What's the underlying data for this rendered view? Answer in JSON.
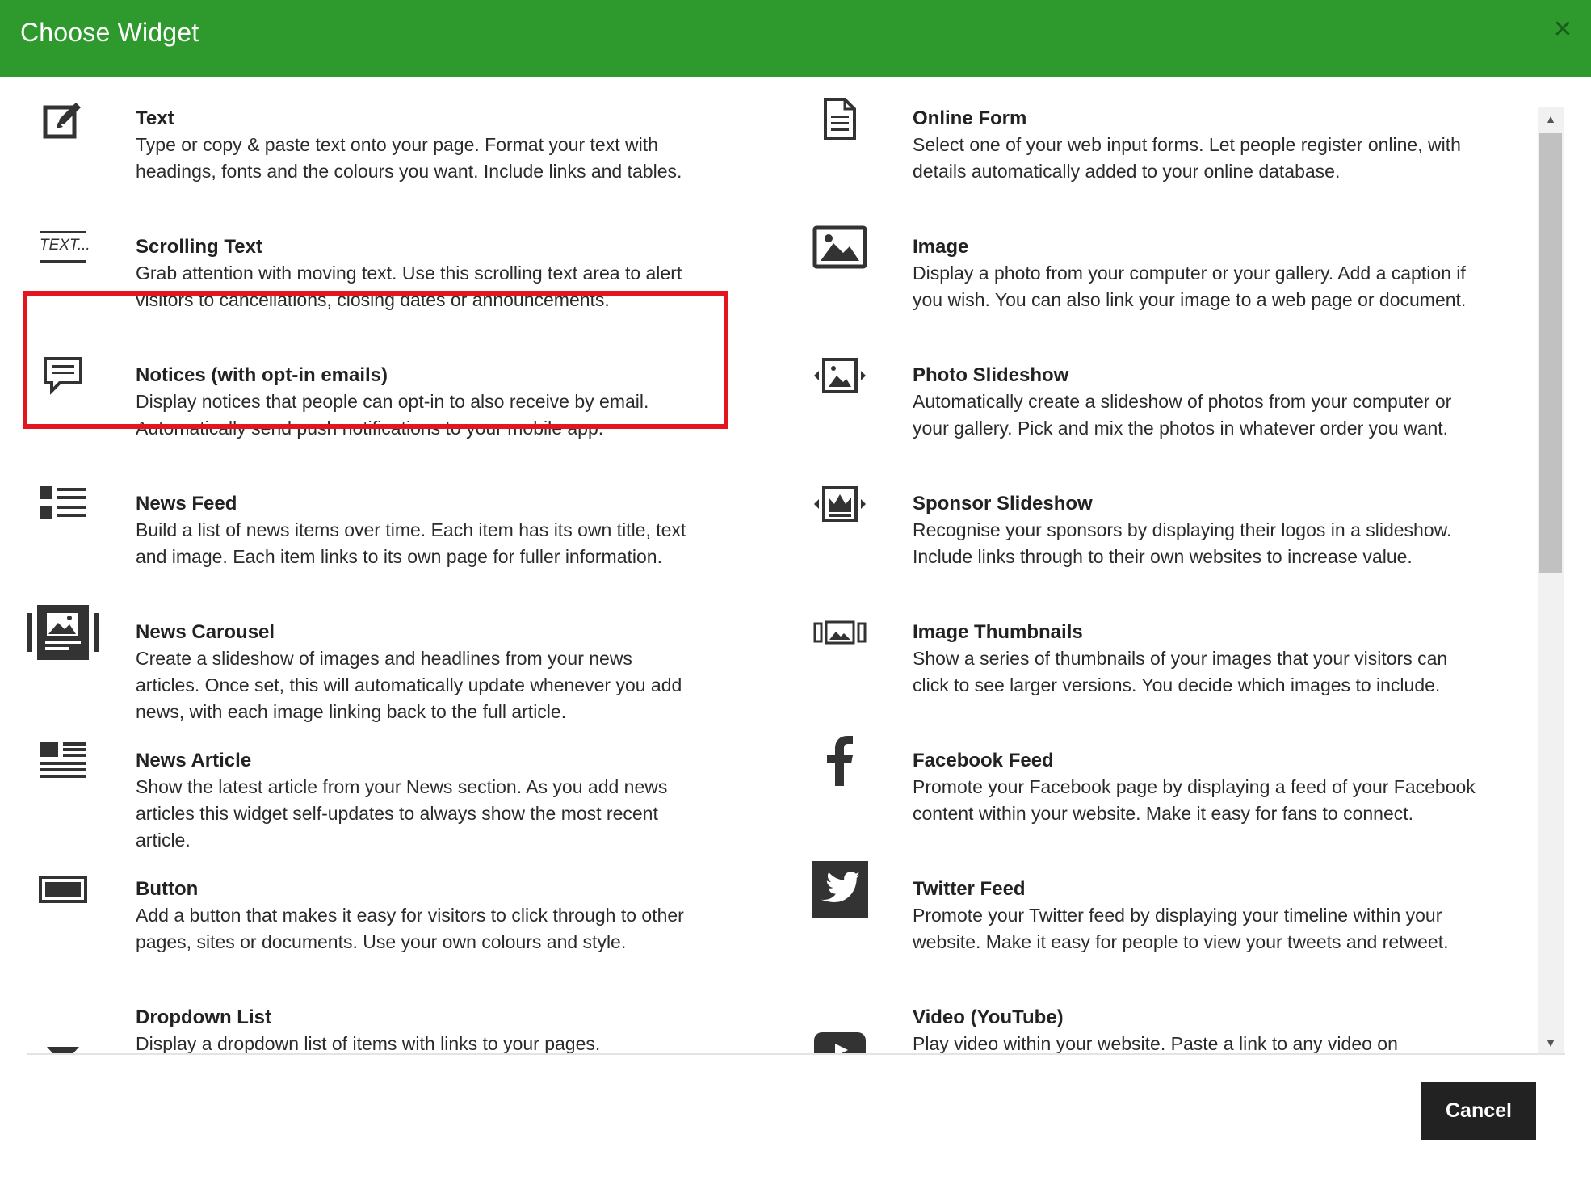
{
  "dialog": {
    "title": "Choose Widget",
    "close_icon": "close-icon"
  },
  "left_items": [
    {
      "title": "Text",
      "desc": "Type or copy & paste text onto your page. Format your text with headings, fonts and the colours you want. Include links and tables.",
      "icon": "edit-icon"
    },
    {
      "title": "Scrolling Text",
      "desc": "Grab attention with moving text. Use this scrolling text area to alert visitors to cancellations, closing dates or announcements.",
      "icon": "scrolling-text-icon",
      "icon_text": "TEXT..."
    },
    {
      "title": "Notices (with opt-in emails)",
      "desc": "Display notices that people can opt-in to also receive by email. Automatically send push notifications to your mobile app.",
      "icon": "comment-icon"
    },
    {
      "title": "News Feed",
      "desc": "Build a list of news items over time. Each item has its own title, text and image. Each item links to its own page for fuller information.",
      "icon": "list-icon"
    },
    {
      "title": "News Carousel",
      "desc": "Create a slideshow of images and headlines from your news articles. Once set, this will automatically update whenever you add news, with each image linking back to the full article.",
      "icon": "carousel-icon"
    },
    {
      "title": "News Article",
      "desc": "Show the latest article from your News section. As you add news articles this widget self-updates to always show the most recent article.",
      "icon": "article-icon"
    },
    {
      "title": "Button",
      "desc": "Add a button that makes it easy for visitors to click through to other pages, sites or documents. Use your own colours and style.",
      "icon": "button-icon"
    },
    {
      "title": "Dropdown List",
      "desc": "Display a dropdown list of items with links to your pages.",
      "icon": "dropdown-icon"
    }
  ],
  "right_items": [
    {
      "title": "Online Form",
      "desc": "Select one of your web input forms. Let people register online, with details automatically added to your online database.",
      "icon": "document-icon"
    },
    {
      "title": "Image",
      "desc": "Display a photo from your computer or your gallery. Add a caption if you wish. You can also link your image to a web page or document.",
      "icon": "image-icon"
    },
    {
      "title": "Photo Slideshow",
      "desc": "Automatically create a slideshow of photos from your computer or your gallery. Pick and mix the photos in whatever order you want.",
      "icon": "slideshow-icon"
    },
    {
      "title": "Sponsor Slideshow",
      "desc": "Recognise your sponsors by displaying their logos in a slideshow. Include links through to their own websites to increase value.",
      "icon": "sponsor-slideshow-icon"
    },
    {
      "title": "Image Thumbnails",
      "desc": "Show a series of thumbnails of your images that your visitors can click to see larger versions. You decide which images to include.",
      "icon": "thumbnails-icon"
    },
    {
      "title": "Facebook Feed",
      "desc": "Promote your Facebook page by displaying a feed of your Facebook content within your website. Make it easy for fans to connect.",
      "icon": "facebook-icon"
    },
    {
      "title": "Twitter Feed",
      "desc": "Promote your Twitter feed by displaying your timeline within your website. Make it easy for people to view your tweets and retweet.",
      "icon": "twitter-icon"
    },
    {
      "title": "Video (YouTube)",
      "desc": "Play video within your website. Paste a link to any video on",
      "icon": "youtube-icon"
    }
  ],
  "selected_widget": "Scrolling Text",
  "footer": {
    "cancel_label": "Cancel"
  },
  "colors": {
    "header": "#2e9a2e",
    "selection": "#e3161d",
    "button": "#222222"
  }
}
